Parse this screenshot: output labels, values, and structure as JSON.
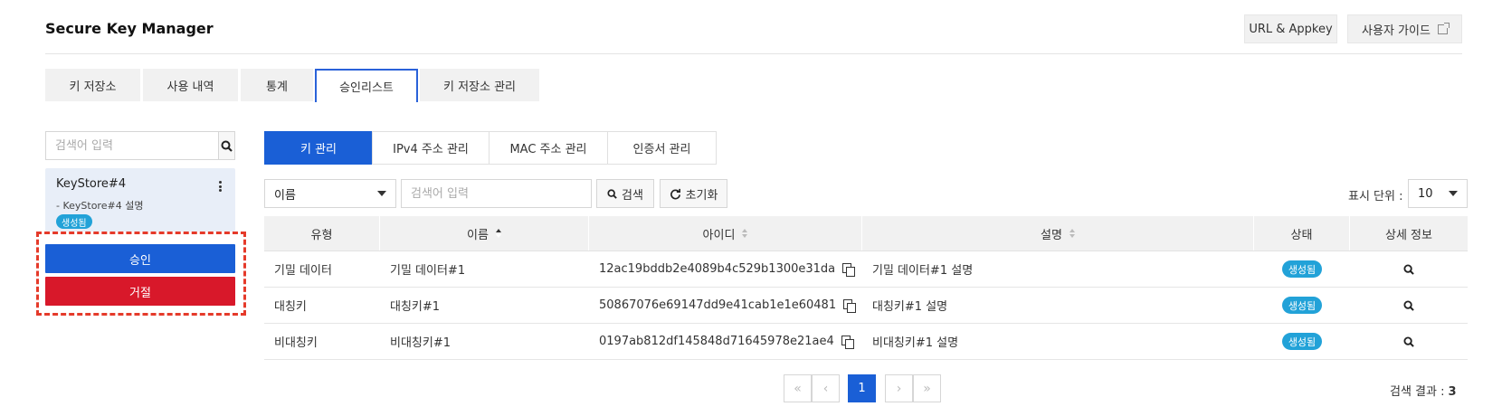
{
  "header": {
    "title": "Secure Key Manager",
    "url_appkey_label": "URL & Appkey",
    "user_guide_label": "사용자 가이드"
  },
  "main_tabs": [
    {
      "label": "키 저장소",
      "active": false
    },
    {
      "label": "사용 내역",
      "active": false
    },
    {
      "label": "통계",
      "active": false
    },
    {
      "label": "승인리스트",
      "active": true
    },
    {
      "label": "키 저장소 관리",
      "active": false
    }
  ],
  "sidebar": {
    "search_placeholder": "검색어 입력",
    "keystore": {
      "name": "KeyStore#4",
      "description": "- KeyStore#4 설명",
      "status": "생성됨"
    },
    "approve_label": "승인",
    "reject_label": "거절"
  },
  "sub_tabs": [
    {
      "label": "키 관리",
      "active": true
    },
    {
      "label": "IPv4 주소 관리",
      "active": false
    },
    {
      "label": "MAC 주소 관리",
      "active": false
    },
    {
      "label": "인증서 관리",
      "active": false
    }
  ],
  "filter": {
    "field_selected": "이름",
    "search_placeholder": "검색어 입력",
    "search_label": "검색",
    "reset_label": "초기화",
    "page_size_label": "표시 단위 :",
    "page_size_value": "10"
  },
  "table": {
    "columns": [
      "유형",
      "이름",
      "아이디",
      "설명",
      "상태",
      "상세 정보"
    ],
    "rows": [
      {
        "type": "기밀 데이터",
        "name": "기밀 데이터#1",
        "id": "12ac19bddb2e4089b4c529b1300e31da",
        "description": "기밀 데이터#1 설명",
        "status": "생성됨"
      },
      {
        "type": "대칭키",
        "name": "대칭키#1",
        "id": "50867076e69147dd9e41cab1e1e60481",
        "description": "대칭키#1 설명",
        "status": "생성됨"
      },
      {
        "type": "비대칭키",
        "name": "비대칭키#1",
        "id": "0197ab812df145848d71645978e21ae4",
        "description": "비대칭키#1 설명",
        "status": "생성됨"
      }
    ]
  },
  "pagination": {
    "current_page": "1",
    "first": "«",
    "prev": "‹",
    "next": "›",
    "last": "»"
  },
  "result": {
    "label": "검색 결과 :",
    "count": "3"
  },
  "colors": {
    "accent": "#1a5fd6",
    "danger": "#d8182a",
    "badge": "#22a2d8",
    "highlight": "#e53a2a"
  }
}
